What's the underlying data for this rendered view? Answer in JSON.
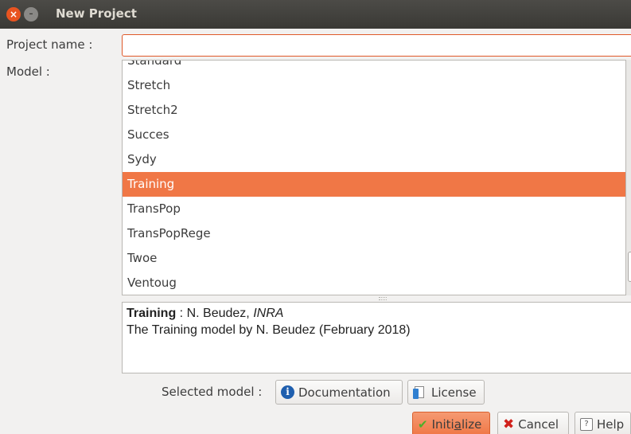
{
  "window": {
    "title": "New Project",
    "close_glyph": "×",
    "min_glyph": "–"
  },
  "form": {
    "project_name_label": "Project name :",
    "project_name_value": "",
    "model_label": "Model :"
  },
  "models": [
    "Standard",
    "Stretch",
    "Stretch2",
    "Succes",
    "Sydy",
    "Training",
    "TransPop",
    "TransPopRege",
    "Twoe",
    "Ventoug"
  ],
  "selected_model_index": 5,
  "description": {
    "name": "Training",
    "separator": " : ",
    "author": "N. Beudez, ",
    "institute": "INRA",
    "text": "The Training model by N. Beudez (February 2018)"
  },
  "selected_model_bar": {
    "label": "Selected model :",
    "documentation": "Documentation",
    "license": "License"
  },
  "actions": {
    "initialize_pre": "Initi",
    "initialize_mnemonic": "a",
    "initialize_post": "lize",
    "cancel": "Cancel",
    "help": "Help"
  },
  "icons": {
    "close": "close-icon",
    "minimize": "minimize-icon",
    "documentation": "info-icon",
    "license": "license-icon",
    "initialize": "check-icon",
    "cancel": "cross-icon",
    "help": "help-icon"
  },
  "colors": {
    "accent": "#f07746",
    "titlebar": "#3c3b37",
    "close": "#e95420"
  }
}
